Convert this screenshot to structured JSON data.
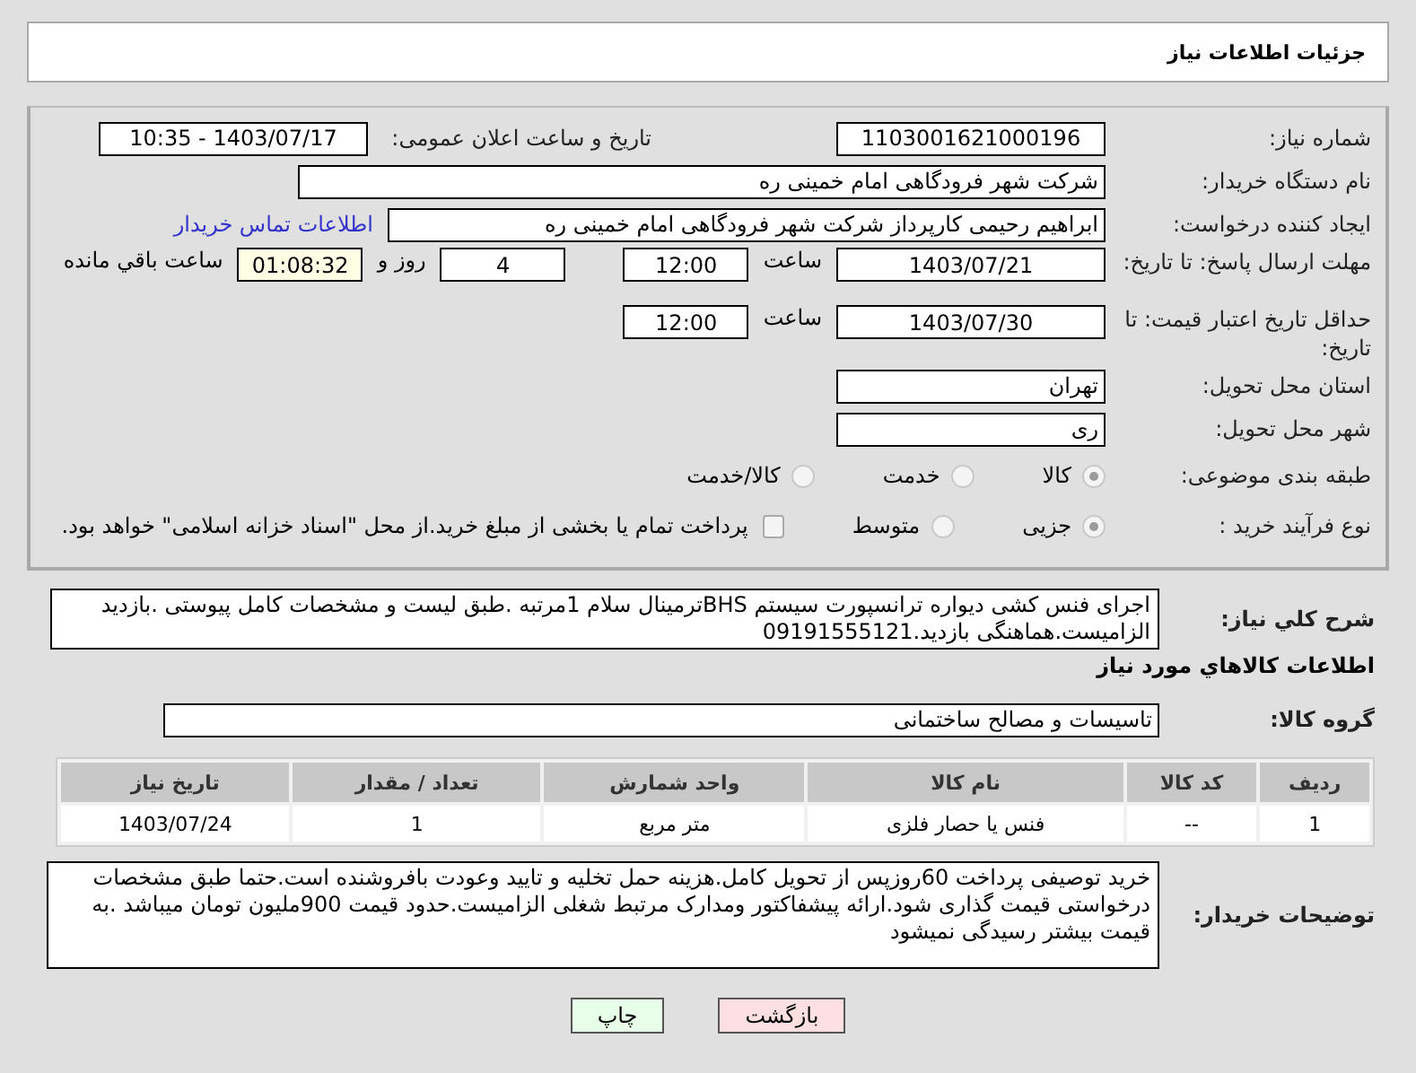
{
  "title": "جزئیات اطلاعات نیاز",
  "need_number": {
    "label": "شماره نیاز:",
    "value": "1103001621000196"
  },
  "announce": {
    "label": "تاریخ و ساعت اعلان عمومی:",
    "value": "1403/07/17 - 10:35"
  },
  "buyer_org": {
    "label": "نام دستگاه خریدار:",
    "value": "شرکت شهر فرودگاهی امام خمینی  ره"
  },
  "requester": {
    "label": "ایجاد کننده درخواست:",
    "value": "ابراهیم رحیمی کارپرداز شرکت شهر فرودگاهی امام خمینی  ره",
    "link": "اطلاعات تماس خریدار"
  },
  "deadline": {
    "label": "مهلت ارسال پاسخ: تا تاریخ:",
    "date": "1403/07/21",
    "time_label": "ساعت",
    "time": "12:00",
    "days": "4",
    "days_label": "روز و",
    "remaining": "01:08:32",
    "remaining_label": "ساعت باقي مانده"
  },
  "validity": {
    "label": "حداقل تاریخ اعتبار قیمت: تا تاریخ:",
    "date": "1403/07/30",
    "time_label": "ساعت",
    "time": "12:00"
  },
  "province": {
    "label": "استان محل تحویل:",
    "value": "تهران"
  },
  "city": {
    "label": "شهر محل تحویل:",
    "value": "ری"
  },
  "category": {
    "label": "طبقه بندی موضوعی:",
    "options": [
      {
        "label": "کالا",
        "selected": true
      },
      {
        "label": "خدمت",
        "selected": false
      },
      {
        "label": "کالا/خدمت",
        "selected": false
      }
    ]
  },
  "process": {
    "label": "نوع فرآیند خرید :",
    "options": [
      {
        "label": "جزیی",
        "selected": true
      },
      {
        "label": "متوسط",
        "selected": false
      }
    ],
    "treasury": {
      "label": "پرداخت تمام یا بخشی از مبلغ خرید.از محل \"اسناد خزانه اسلامی\" خواهد بود.",
      "checked": false
    }
  },
  "description": {
    "label": "شرح کلي نياز:",
    "value": "اجرای فنس کشی دیواره ترانسپورت سیستم BHSترمینال سلام 1مرتبه .طبق لیست و مشخصات کامل پیوستی .بازدید الزامیست.هماهنگی بازدید.09191555121"
  },
  "goods_heading": "اطلاعات كالاهاي مورد نياز",
  "goods_group": {
    "label": "گروه کالا:",
    "value": "تاسیسات و مصالح ساختمانی"
  },
  "table": {
    "columns": [
      "ردیف",
      "کد کالا",
      "نام کالا",
      "واحد شمارش",
      "تعداد / مقدار",
      "تاریخ نیاز"
    ],
    "rows": [
      [
        "1",
        "--",
        "فنس یا حصار فلزی",
        "متر مربع",
        "1",
        "1403/07/24"
      ]
    ]
  },
  "buyer_notes": {
    "label": "توضیحات خریدار:",
    "value": "خرید توصیفی پرداخت 60روزپس از تحویل کامل.هزینه حمل تخلیه و تایید وعودت  بافروشنده است.حتما طبق مشخصات درخواستی قیمت گذاری شود.ارائه پیشفاکتور ومدارک مرتبط شغلی  الزامیست.حدود قیمت 900ملیون تومان میباشد .به قیمت بیشتر رسیدگی نمیشود"
  },
  "buttons": [
    {
      "label": "بازگشت",
      "kind": "back"
    },
    {
      "label": "چاپ",
      "kind": "print"
    }
  ]
}
